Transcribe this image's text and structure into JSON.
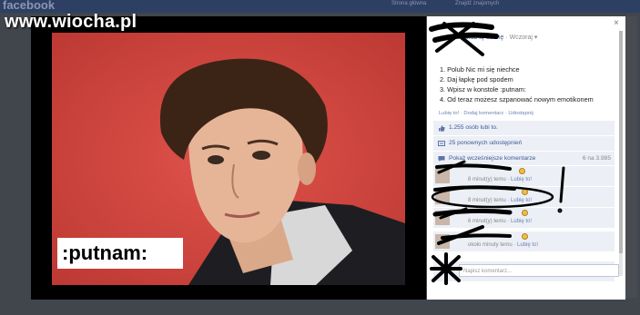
{
  "background": {
    "logo": "facebook",
    "nav_items": [
      "Strona główna",
      "Znajdź znajomych"
    ]
  },
  "watermark": "www.wiocha.pl",
  "photo": {
    "caption": ":putnam:"
  },
  "panel": {
    "close_label": "×",
    "page_meta": {
      "like_page": "olub tę stronę",
      "separator": " · ",
      "time": "Wczoraj",
      "menu_caret": "▾"
    },
    "post_lines": [
      "1. Polub Nic mi się niechce",
      "2. Daj łapkę pod spodem",
      "3. Wpisz w konstole :putnam:",
      "4. Od teraz możesz szpanować nowym emotikonem"
    ],
    "actions": {
      "like": "Lubię to!",
      "comment": "Dodaj komentarz",
      "share": "Udostępnij",
      "sep": " · "
    },
    "likes_text": "1.255 osób lubi to.",
    "shares_text": "25 ponownych udostępnień",
    "prev_comments": "Pokaż wcześniejsze komentarze",
    "comments_count": "6 na 3.985",
    "comments": [
      {
        "time": "8 minut(y) temu",
        "like": "Lubię to!"
      },
      {
        "time": "8 minut(y) temu",
        "like": "Lubię to!"
      },
      {
        "time": "6 minut(y) temu",
        "like": "Lubię to!"
      },
      {
        "time": "około minuty temu",
        "like": "Lubię to!"
      }
    ],
    "comment_placeholder": "Napisz komentarz..."
  },
  "colors": {
    "fb_blue": "#3b5998",
    "link": "#6d84b4",
    "scribble": "#000000"
  }
}
